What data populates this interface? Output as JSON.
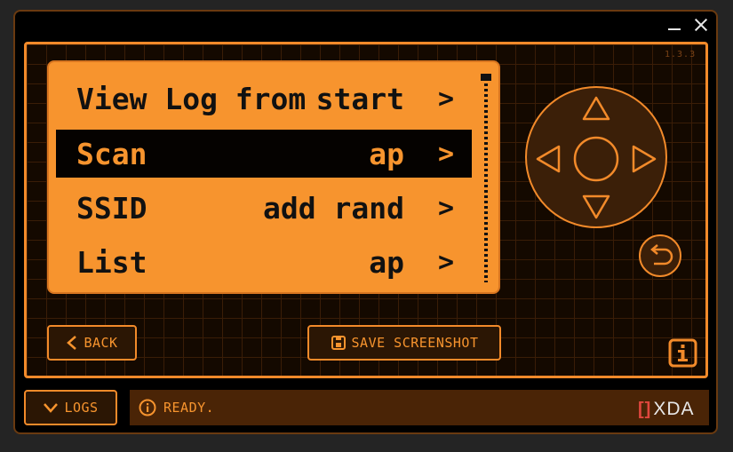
{
  "window": {
    "controls": [
      "minimize-icon",
      "close-icon"
    ]
  },
  "device": {
    "version": "1.3.3"
  },
  "menu": {
    "rows": [
      {
        "label": "View Log from",
        "value": "start",
        "chevron": ">",
        "selected": false
      },
      {
        "label": "Scan",
        "value": "ap",
        "chevron": ">",
        "selected": true
      },
      {
        "label": "SSID",
        "value": "add rand",
        "chevron": ">",
        "selected": false
      },
      {
        "label": "List",
        "value": "ap",
        "chevron": ">",
        "selected": false
      }
    ]
  },
  "buttons": {
    "back": "BACK",
    "save_screenshot": "SAVE SCREENSHOT",
    "logs": "LOGS"
  },
  "status": {
    "text": "READY."
  },
  "watermark": "XDA",
  "colors": {
    "accent": "#f7942e",
    "screen_bg": "#f7942e",
    "selected_row_bg": "#050200",
    "device_bg": "#140900",
    "status_bg": "#4a2406"
  }
}
